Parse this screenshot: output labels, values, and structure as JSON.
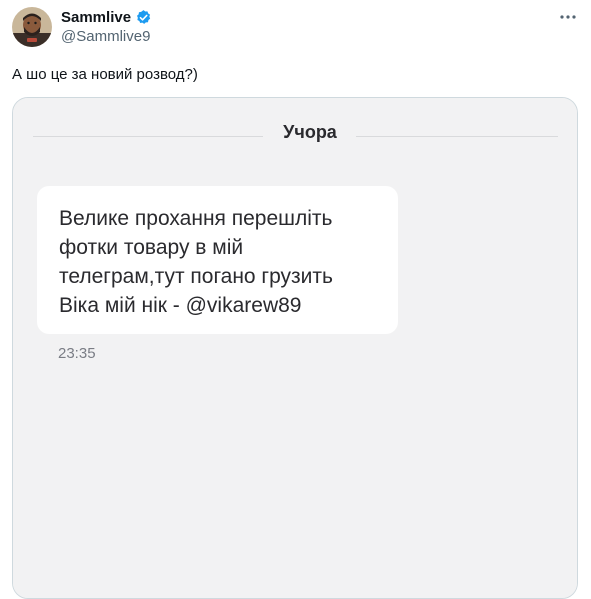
{
  "tweet": {
    "display_name": "Sammlive",
    "handle": "@Sammlive9",
    "text": "А шо це за новий розвод?)"
  },
  "icons": {
    "avatar": "avatar",
    "verified": "verified-badge-icon",
    "more": "more-options-icon"
  },
  "colors": {
    "verified_blue": "#1d9bf0",
    "media_background": "#f2f2f3",
    "bubble_background": "#ffffff"
  },
  "screenshot": {
    "contact_name": "Учора",
    "message_lines": [
      "Велике прохання перешліть",
      "фотки товару в мій",
      "телеграм,тут погано грузить",
      "Віка мій нік - @vikarew89"
    ],
    "time": "23:35"
  }
}
